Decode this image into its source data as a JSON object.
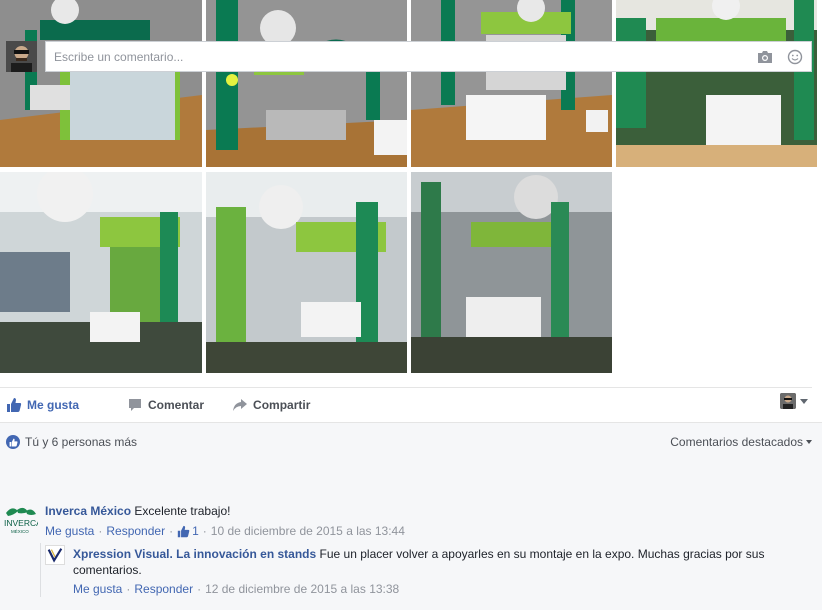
{
  "post": {
    "photo_grid": {
      "photos": [
        {
          "label": "Stand Inverca render 1"
        },
        {
          "label": "Stand Inverca render 2"
        },
        {
          "label": "Stand Inverca render 3"
        },
        {
          "label": "Stand Inverca foto 4"
        },
        {
          "label": "Stand Inverca foto 5"
        },
        {
          "label": "Stand Inverca foto 6"
        },
        {
          "label": "Stand Inverca foto 7"
        }
      ]
    },
    "actions": {
      "like_label": "Me gusta",
      "comment_label": "Comentar",
      "share_label": "Compartir"
    },
    "reactions": {
      "summary": "Tú y 6 personas más"
    },
    "comments_sort": {
      "label": "Comentarios destacados"
    },
    "composer": {
      "placeholder": "Escribe un comentario..."
    },
    "comments": [
      {
        "author": "Inverca México",
        "text": "Excelente trabajo!",
        "like_label": "Me gusta",
        "reply_label": "Responder",
        "like_count": "1",
        "timestamp": "10 de diciembre de 2015 a las 13:44",
        "avatar_text": "INVERCA",
        "avatar_subtext": "MÉXICO"
      },
      {
        "author": "Xpression Visual. La innovación en stands",
        "text": "Fue un placer volver a apoyarles en su montaje en la expo. Muchas gracias por sus comentarios.",
        "like_label": "Me gusta",
        "reply_label": "Responder",
        "timestamp": "12 de diciembre de 2015 a las 13:38"
      }
    ]
  },
  "colors": {
    "link": "#365899",
    "accent": "#4267b2",
    "brand_green": "#8dc63f",
    "dark_green": "#0a6b4f",
    "meta": "#90949c"
  },
  "icons": {
    "like": "thumbs-up-icon",
    "comment": "speech-bubble-icon",
    "share": "share-arrow-icon",
    "camera": "camera-icon",
    "emoji": "smiley-icon"
  }
}
